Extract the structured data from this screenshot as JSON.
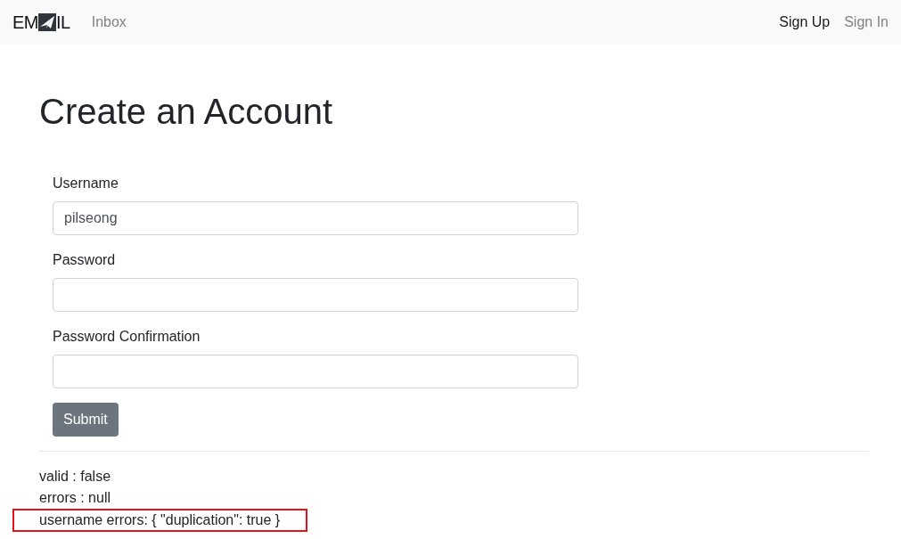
{
  "navbar": {
    "logo": {
      "left": "EM",
      "right": "IL"
    },
    "links": [
      {
        "label": "Inbox",
        "selected": false
      }
    ],
    "auth_links": [
      {
        "label": "Sign Up",
        "selected": true
      },
      {
        "label": "Sign In",
        "selected": false
      }
    ]
  },
  "title": "Create an Account",
  "form": {
    "fields": [
      {
        "label": "Username",
        "value": "pilseong"
      },
      {
        "label": "Password"
      },
      {
        "label": "Password Confirmation"
      }
    ],
    "submit": "Submit"
  },
  "debug_lines": [
    {
      "text": "valid : false",
      "highlighted": false
    },
    {
      "text": "errors : null",
      "highlighted": false
    },
    {
      "text": "username errors: { \"duplication\": true }",
      "highlighted": true
    }
  ]
}
